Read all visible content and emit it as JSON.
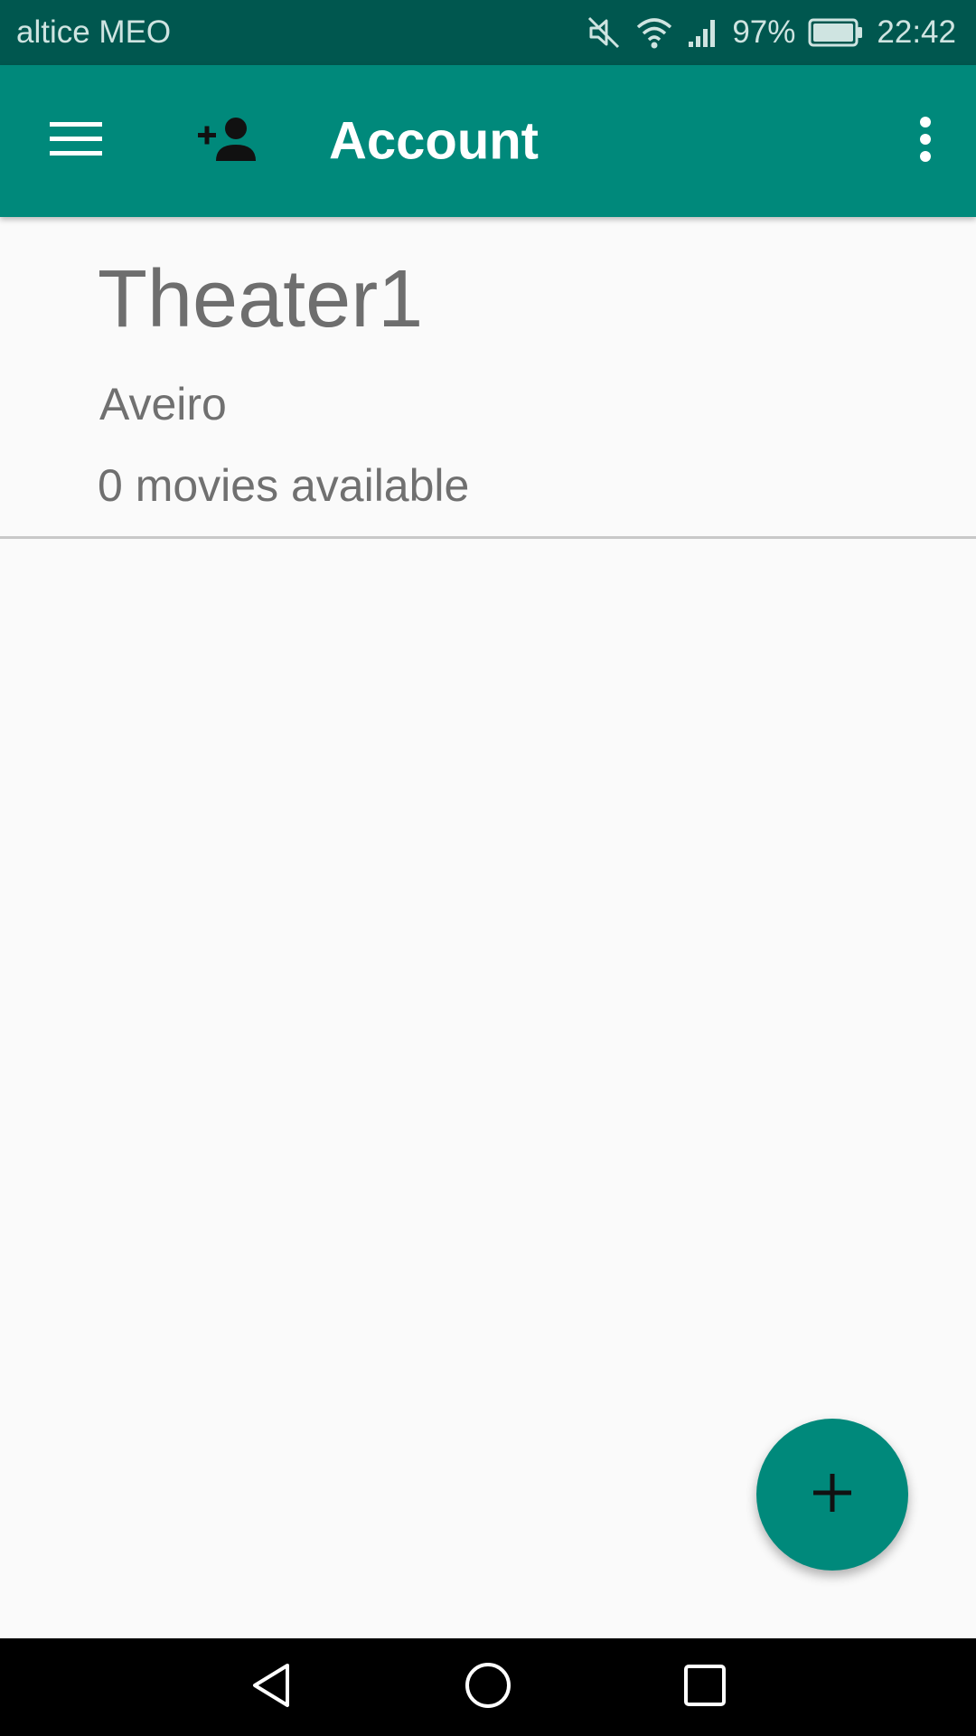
{
  "status_bar": {
    "carrier": "altice MEO",
    "battery_percent": "97%",
    "time": "22:42",
    "icons": [
      "mute-icon",
      "wifi-icon",
      "signal-icon",
      "battery-icon"
    ]
  },
  "app_bar": {
    "title": "Account",
    "icons": [
      "menu-icon",
      "add-person-icon",
      "overflow-menu-icon"
    ],
    "color": "#00897b"
  },
  "theater": {
    "name": "Theater1",
    "city": "Aveiro",
    "movie_count": "0 movies available"
  },
  "fab": {
    "icon": "plus-icon",
    "color": "#00897b"
  },
  "nav_bar": {
    "icons": [
      "back-icon",
      "home-icon",
      "recents-icon"
    ]
  },
  "colors": {
    "status_bar": "#00574f",
    "primary": "#00897b",
    "background": "#fafafa"
  }
}
